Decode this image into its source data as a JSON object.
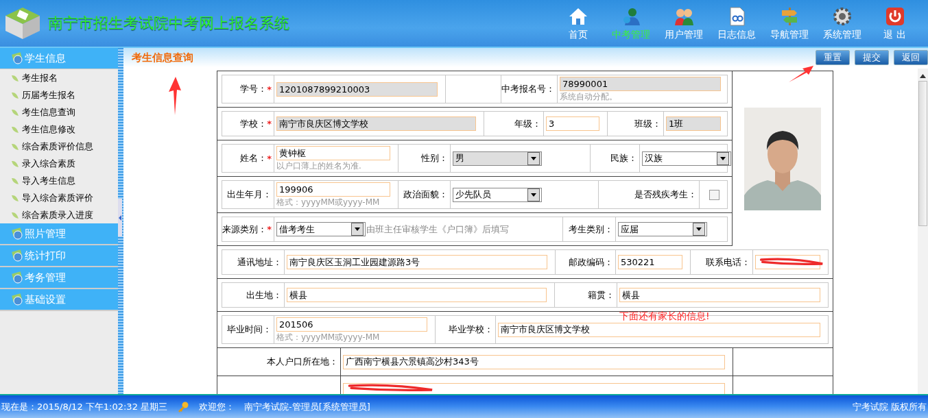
{
  "header": {
    "title": "南宁市招生考试院中考网上报名系统",
    "nav": [
      {
        "label": "首页",
        "selected": false
      },
      {
        "label": "中考管理",
        "selected": true
      },
      {
        "label": "用户管理",
        "selected": false
      },
      {
        "label": "日志信息",
        "selected": false
      },
      {
        "label": "导航管理",
        "selected": false
      },
      {
        "label": "系统管理",
        "selected": false
      },
      {
        "label": "退 出",
        "selected": false
      }
    ]
  },
  "sidebar": {
    "groups": [
      {
        "label": "学生信息",
        "expanded": true,
        "items": [
          "考生报名",
          "历届考生报名",
          "考生信息查询",
          "考生信息修改",
          "综合素质评价信息",
          "录入综合素质",
          "导入考生信息",
          "导入综合素质评价",
          "综合素质录入进度"
        ]
      },
      {
        "label": "照片管理",
        "expanded": false
      },
      {
        "label": "统计打印",
        "expanded": false
      },
      {
        "label": "考务管理",
        "expanded": false
      },
      {
        "label": "基础设置",
        "expanded": false
      }
    ]
  },
  "page": {
    "title": "考生信息查询",
    "buttons": [
      "重置",
      "提交",
      "返回"
    ]
  },
  "form": {
    "rows": [
      {
        "fields": [
          {
            "label": "学号：",
            "required_mark": "*",
            "kind": "text",
            "value": "1201087899210003",
            "readonly": true
          },
          {
            "kind": "empty"
          },
          {
            "label": "中考报名号：",
            "kind": "text",
            "value": "78990001",
            "readonly": true,
            "hint": "系统自动分配。"
          }
        ]
      },
      {
        "fields": [
          {
            "label": "学校：",
            "required_mark": "*",
            "kind": "text",
            "value": "南宁市良庆区博文学校",
            "readonly": true
          },
          {
            "label": "年级：",
            "kind": "text",
            "value": "3",
            "readonly": false
          },
          {
            "label": "班级：",
            "kind": "text",
            "value": "1班",
            "readonly": true
          }
        ]
      },
      {
        "fields": [
          {
            "label": "姓名：",
            "required_mark": "*",
            "kind": "text",
            "value": "黄钟枢",
            "readonly": false,
            "hint": "以户口薄上的姓名为准."
          },
          {
            "label": "性别：",
            "kind": "select",
            "value": "男",
            "readonly": true
          },
          {
            "label": "民族：",
            "kind": "select",
            "value": "汉族",
            "readonly": false
          }
        ]
      },
      {
        "fields": [
          {
            "label": "出生年月：",
            "kind": "text",
            "value": "199906",
            "readonly": false,
            "hint": "格式：yyyyMM或yyyy-MM"
          },
          {
            "label": "政治面貌：",
            "kind": "select",
            "value": "少先队员",
            "readonly": false
          },
          {
            "label": "是否残疾考生：",
            "kind": "checkbox",
            "checked": false
          }
        ]
      },
      {
        "fields": [
          {
            "label": "来源类别：",
            "required_mark": "*",
            "kind": "select",
            "value": "借考考生",
            "readonly": false,
            "note": "由班主任审核学生《户口簿》后填写"
          },
          {
            "label": "考生类别：",
            "kind": "select",
            "value": "应届",
            "readonly": false
          }
        ]
      },
      {
        "fields": [
          {
            "label": "通讯地址：",
            "kind": "text",
            "value": "南宁良庆区玉洞工业园建源路3号",
            "readonly": false
          },
          {
            "label": "邮政编码：",
            "kind": "text",
            "value": "530221",
            "readonly": false
          },
          {
            "label": "联系电话：",
            "kind": "text",
            "readonly": false,
            "redacted": true
          }
        ]
      },
      {
        "fields": [
          {
            "label": "出生地：",
            "kind": "text",
            "value": "横县",
            "readonly": false
          },
          {
            "label": "籍贯：",
            "kind": "text",
            "value": "横县",
            "readonly": false
          }
        ]
      },
      {
        "fields": [
          {
            "label": "毕业时间：",
            "kind": "text",
            "value": "201506",
            "readonly": false,
            "hint": "格式：yyyyMM或yyyy-MM"
          },
          {
            "label": "毕业学校：",
            "kind": "text",
            "value": "南宁市良庆区博文学校",
            "readonly": false
          }
        ]
      },
      {
        "fields": [
          {
            "label": "本人户口所在地：",
            "kind": "text",
            "value": "广西南宁横县六景镇高沙村343号",
            "readonly": false
          },
          {
            "kind": "empty"
          }
        ]
      },
      {
        "fields": [
          {
            "kind": "text",
            "readonly": false,
            "redacted": true
          },
          {
            "kind": "empty"
          }
        ]
      }
    ]
  },
  "annotation_note": "下面还有家长的信息!",
  "status_bar": {
    "time": "现在是：2015/8/12 下午1:02:32 星期三",
    "welcome": "欢迎您：",
    "user": "南宁考试院-管理员[系统管理员]",
    "copyright": "宁考试院 版权所有"
  }
}
